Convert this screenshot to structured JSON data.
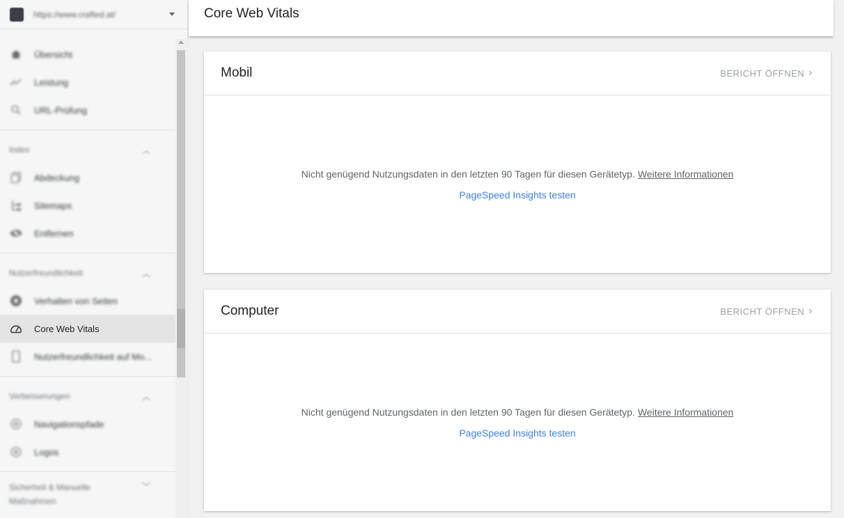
{
  "sidebar": {
    "property_url": "https://www.crafted.at/",
    "groups": [
      {
        "items": [
          {
            "label": "Übersicht",
            "icon": "home-icon"
          },
          {
            "label": "Leistung",
            "icon": "trending-up-icon"
          },
          {
            "label": "URL-Prüfung",
            "icon": "search-icon"
          }
        ]
      },
      {
        "title": "Index",
        "items": [
          {
            "label": "Abdeckung",
            "icon": "copy-icon"
          },
          {
            "label": "Sitemaps",
            "icon": "sitemap-icon"
          },
          {
            "label": "Entfernen",
            "icon": "visibility-off-icon"
          }
        ]
      },
      {
        "title": "Nutzerfreundlichkeit",
        "items": [
          {
            "label": "Verhalten von Seiten",
            "icon": "gear-badge-icon"
          },
          {
            "label": "Core Web Vitals",
            "icon": "speedometer-icon"
          },
          {
            "label": "Nutzerfreundlichkeit auf Mo...",
            "icon": "smartphone-icon"
          }
        ]
      },
      {
        "title": "Verbesserungen",
        "items": [
          {
            "label": "Navigationspfade",
            "icon": "layers-icon"
          },
          {
            "label": "Logos",
            "icon": "layers-icon"
          }
        ]
      },
      {
        "title": "Sicherheit & Manuelle Maßnahmen"
      }
    ]
  },
  "header": {
    "title": "Core Web Vitals"
  },
  "cards": [
    {
      "title": "Mobil",
      "open_label": "BERICHT ÖFFNEN",
      "message": "Nicht genügend Nutzungsdaten in den letzten 90 Tagen für diesen Gerätetyp.",
      "more_link": "Weitere Informationen",
      "psi_link": "PageSpeed Insights testen"
    },
    {
      "title": "Computer",
      "open_label": "BERICHT ÖFFNEN",
      "message": "Nicht genügend Nutzungsdaten in den letzten 90 Tagen für diesen Gerätetyp.",
      "more_link": "Weitere Informationen",
      "psi_link": "PageSpeed Insights testen"
    }
  ],
  "colors": {
    "link_blue": "#3f7ee0",
    "active_item_bg": "#e4e4e4"
  }
}
